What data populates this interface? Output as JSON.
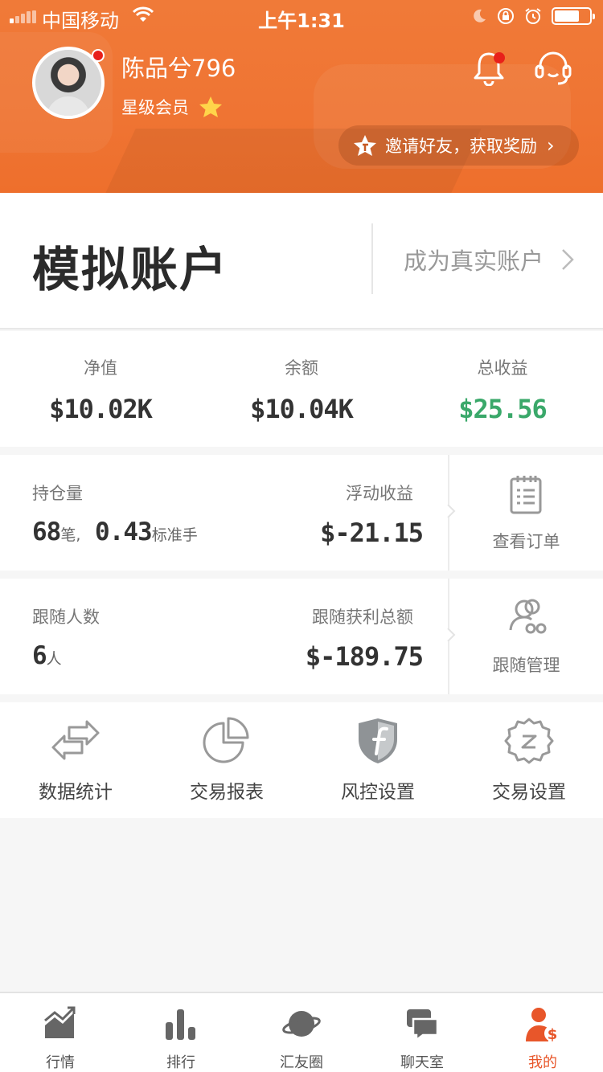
{
  "status_bar": {
    "carrier": "中国移动",
    "time": "上午1:31"
  },
  "profile": {
    "name": "陈品兮796",
    "member_level": "星级会员",
    "invite_text": "邀请好友，获取奖励"
  },
  "account": {
    "title": "模拟账户",
    "upgrade_link": "成为真实账户"
  },
  "stats": [
    {
      "label": "净值",
      "value": "$10.02K"
    },
    {
      "label": "余额",
      "value": "$10.04K"
    },
    {
      "label": "总收益",
      "value": "$25.56"
    }
  ],
  "positions": {
    "label": "持仓量",
    "count": "68",
    "count_unit": "笔,",
    "lots": "0.43",
    "lots_unit": "标准手",
    "floating_label": "浮动收益",
    "floating_value": "$-21.15",
    "action": "查看订单"
  },
  "followers": {
    "label": "跟随人数",
    "count": "6",
    "count_unit": "人",
    "profit_label": "跟随获利总额",
    "profit_value": "$-189.75",
    "action": "跟随管理"
  },
  "tools": [
    {
      "label": "数据统计",
      "icon": "swap-arrows-icon"
    },
    {
      "label": "交易报表",
      "icon": "pie-chart-icon"
    },
    {
      "label": "风控设置",
      "icon": "shield-f-icon"
    },
    {
      "label": "交易设置",
      "icon": "gear-icon"
    }
  ],
  "tabs": [
    {
      "label": "行情",
      "icon": "market-chart-icon"
    },
    {
      "label": "排行",
      "icon": "ranking-bars-icon"
    },
    {
      "label": "汇友圈",
      "icon": "planet-icon"
    },
    {
      "label": "聊天室",
      "icon": "chat-bubbles-icon"
    },
    {
      "label": "我的",
      "icon": "user-dollar-icon",
      "active": true
    }
  ],
  "colors": {
    "brand": "#ef7433",
    "profit": "#3aa86a",
    "notify": "#e8201a",
    "active_tab": "#e8562a"
  }
}
